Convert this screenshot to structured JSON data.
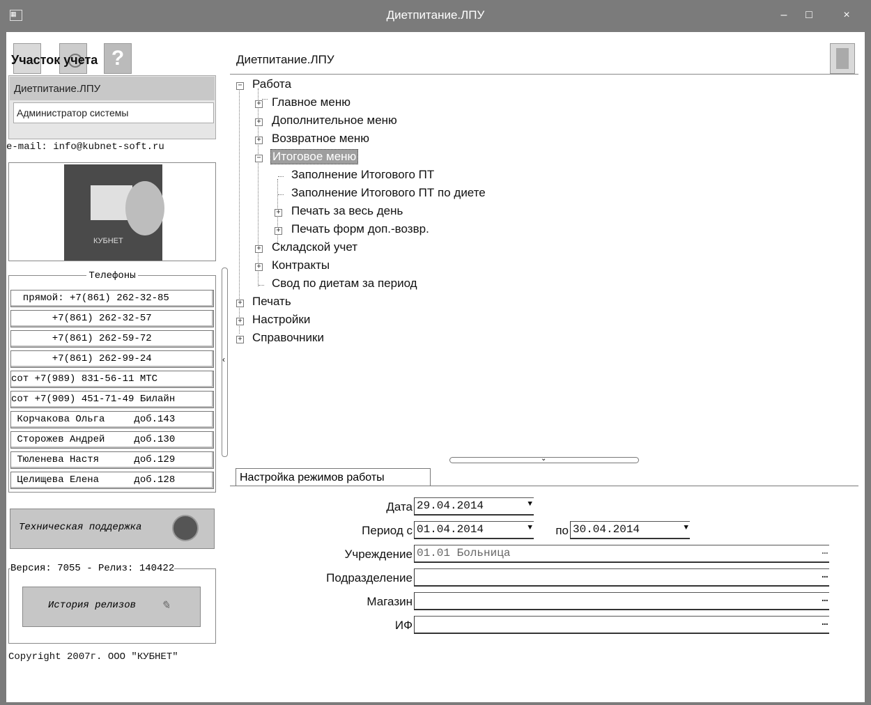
{
  "window": {
    "title": "Диетпитание.ЛПУ",
    "minimize": "–",
    "maximize": "□",
    "close": "×"
  },
  "left": {
    "title": "Участок учета",
    "accounts": [
      "Диетпитание.ЛПУ",
      "Администратор системы"
    ],
    "email": "e-mail: info@kubnet-soft.ru",
    "logo_text": "КУБНЕТ",
    "phones_caption": "Телефоны",
    "phones": [
      "  прямой: +7(861) 262-32-85",
      "       +7(861) 262-32-57",
      "       +7(861) 262-59-72",
      "       +7(861) 262-99-24",
      "сот +7(989) 831-56-11 МТС",
      "сот +7(909) 451-71-49 Билайн",
      " Корчакова Ольга     доб.143",
      " Сторожев Андрей     доб.130",
      " Тюленева Настя      доб.129",
      " Целищева Елена      доб.128"
    ],
    "support_label": "Техническая поддержка",
    "version": "Версия: 7055 - Релиз: 140422",
    "history_label": "История релизов",
    "copyright": "Copyright 2007г. ООО \"КУБНЕТ\""
  },
  "right": {
    "title": "Диетпитание.ЛПУ",
    "tree": {
      "root1": "Работа",
      "main_menu": "Главное меню",
      "extra_menu": "Дополнительное меню",
      "return_menu": "Возвратное меню",
      "total_menu": "Итоговое меню",
      "fill_total": "Заполнение Итогового ПТ",
      "fill_total_diet": "Заполнение Итогового ПТ по диете",
      "print_day": "Печать за весь день",
      "print_forms": "Печать форм доп.-возвр.",
      "warehouse": "Складской учет",
      "contracts": "Контракты",
      "diet_summary": "Свод по диетам за период",
      "print": "Печать",
      "settings": "Настройки",
      "references": "Справочники"
    },
    "tab": "Настройка режимов работы",
    "form": {
      "date_label": "Дата",
      "date_value": "29.04.2014",
      "period_label": "Период с",
      "period_from": "01.04.2014",
      "period_to_label": "по",
      "period_to": "30.04.2014",
      "institution_label": "Учреждение",
      "institution_value": "01.01 Больница",
      "division_label": "Подразделение",
      "division_value": "",
      "store_label": "Магазин",
      "store_value": "",
      "if_label": "ИФ",
      "if_value": ""
    }
  }
}
